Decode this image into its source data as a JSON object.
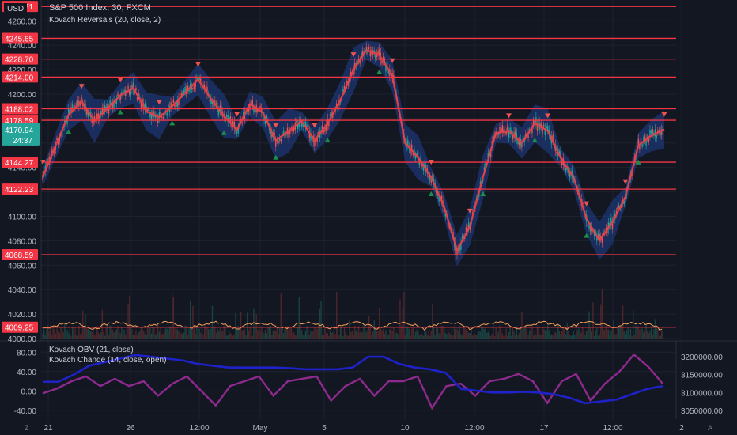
{
  "header": {
    "currency": "USD",
    "title": "S&P 500 Index, 30, FXCM",
    "indicator": "Kovach Reversals (20, close, 2)"
  },
  "lower_pane": {
    "indicator1": "Kovach OBV (21, close)",
    "indicator2": "Kovach Chande (14, close, open)"
  },
  "price_axis": {
    "ticks": [
      "4260.00",
      "4240.00",
      "4220.00",
      "4200.00",
      "4180.00",
      "4160.00",
      "4140.00",
      "4120.00",
      "4100.00",
      "4080.00",
      "4060.00",
      "4040.00",
      "4020.00",
      "4000.00"
    ],
    "last_price": "4170.94",
    "countdown": "24:37"
  },
  "levels": [
    "4271.71",
    "4245.65",
    "4228.70",
    "4214.00",
    "4188.02",
    "4178.59",
    "4144.27",
    "4122.23",
    "4068.59",
    "4009.25"
  ],
  "colors": {
    "background": "#131722",
    "level": "#f23645",
    "ma": "#e0414a",
    "band": "#1f3f8f",
    "up": "#26a69a",
    "down": "#ef5350",
    "obv": "#1e22c8",
    "chande": "#8e2a8e",
    "last_price": "#26a69a"
  },
  "osc_left_axis": [
    "80.00",
    "40.00",
    "0.00",
    "-40.00"
  ],
  "osc_right_axis": [
    "3200000.00",
    "3150000.00",
    "3100000.00",
    "3050000.00"
  ],
  "time_axis": [
    "21",
    "26",
    "12:00",
    "May",
    "5",
    "10",
    "12:00",
    "17",
    "12:00",
    "2"
  ],
  "corner": {
    "left": "Z",
    "right": "A"
  },
  "chart_data": {
    "type": "line",
    "title": "S&P 500 Index, 30, FXCM",
    "x": [
      "21",
      "26",
      "12:00",
      "May",
      "5",
      "10",
      "12:00",
      "17",
      "12:00",
      "2"
    ],
    "series": [
      {
        "name": "S&P 500 Index, 30, FXCM",
        "values": [
          4132,
          4158,
          4183,
          4194,
          4178,
          4188,
          4199,
          4205,
          4186,
          4181,
          4190,
          4201,
          4212,
          4196,
          4182,
          4171,
          4192,
          4185,
          4162,
          4170,
          4178,
          4162,
          4176,
          4195,
          4220,
          4236,
          4232,
          4215,
          4160,
          4148,
          4132,
          4108,
          4072,
          4092,
          4132,
          4168,
          4170,
          4160,
          4176,
          4170,
          4148,
          4132,
          4098,
          4080,
          4095,
          4116,
          4158,
          4166,
          4171
        ]
      },
      {
        "name": "Kovach OBV (21, close)",
        "values": [
          3130000,
          3130000,
          3150000,
          3175000,
          3185000,
          3195000,
          3205000,
          3200000,
          3195000,
          3190000,
          3180000,
          3175000,
          3170000,
          3170000,
          3170000,
          3170000,
          3168000,
          3165000,
          3165000,
          3165000,
          3170000,
          3200000,
          3200000,
          3180000,
          3170000,
          3165000,
          3155000,
          3110000,
          3105000,
          3100000,
          3100000,
          3102000,
          3100000,
          3095000,
          3085000,
          3070000,
          3075000,
          3080000,
          3095000,
          3110000,
          3118000
        ]
      },
      {
        "name": "Kovach Chande (14, close, open)",
        "values": [
          -5,
          5,
          20,
          30,
          10,
          25,
          10,
          20,
          -10,
          15,
          30,
          0,
          -30,
          10,
          20,
          30,
          -10,
          20,
          25,
          30,
          -20,
          10,
          25,
          -10,
          20,
          20,
          30,
          -35,
          10,
          15,
          -10,
          20,
          25,
          35,
          20,
          -25,
          20,
          35,
          -20,
          15,
          40,
          75,
          50,
          15
        ]
      }
    ],
    "levels": [
      4271.71,
      4245.65,
      4228.7,
      4214.0,
      4188.02,
      4178.59,
      4144.27,
      4122.23,
      4068.59,
      4009.25
    ],
    "ylim": [
      4000,
      4277
    ],
    "osc_left_ylim": [
      -55,
      100
    ],
    "osc_right_ylim": [
      3030000,
      3240000
    ]
  }
}
